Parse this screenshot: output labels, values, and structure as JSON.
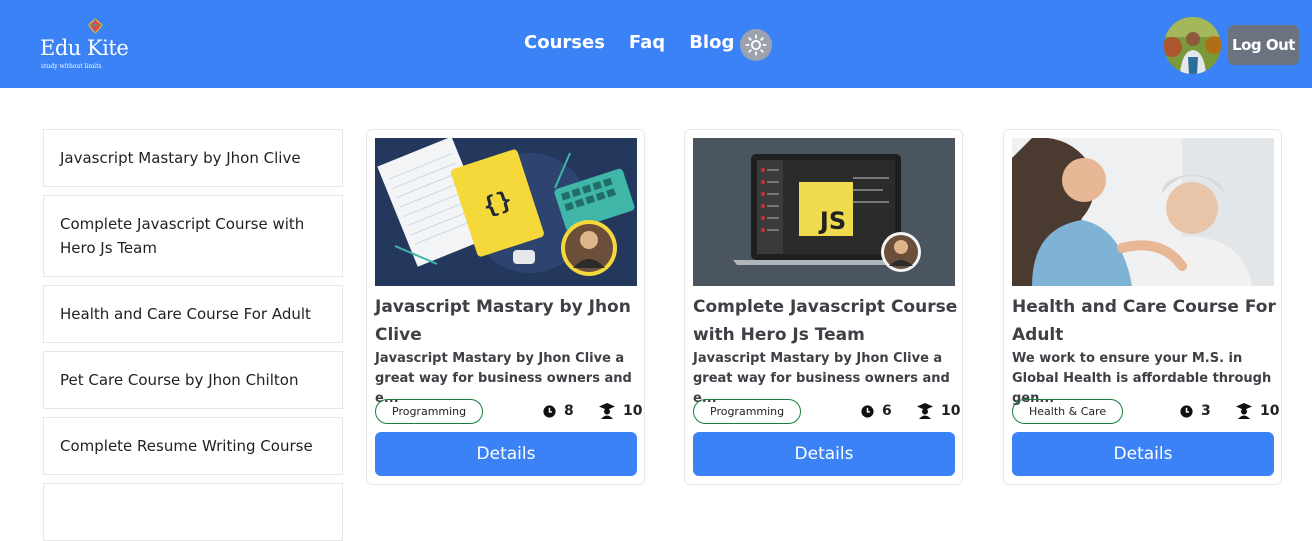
{
  "brand": {
    "name": "Edu Kite",
    "tagline": "study without limits"
  },
  "nav": {
    "links": [
      "Courses",
      "Faq",
      "Blog"
    ]
  },
  "header": {
    "logout_label": "Log Out"
  },
  "sidebar": {
    "items": [
      "Javascript Mastary by Jhon Clive",
      "Complete Javascript Course with Hero Js Team",
      "Health and Care Course For Adult",
      "Pet Care Course by Jhon Chilton",
      "Complete Resume Writing Course"
    ]
  },
  "courses": [
    {
      "title": "Javascript Mastary by Jhon Clive",
      "description": "Javascript Mastary by Jhon Clive a great way for business owners and e...",
      "category": "Programming",
      "duration": "8",
      "students": "10",
      "button": "Details"
    },
    {
      "title": "Complete Javascript Course with Hero Js Team",
      "description": "Javascript Mastary by Jhon Clive a great way for business owners and e...",
      "category": "Programming",
      "duration": "6",
      "students": "10",
      "button": "Details"
    },
    {
      "title": "Health and Care Course For Adult",
      "description": "We work to ensure your M.S. in Global Health is affordable through gen...",
      "category": "Health & Care",
      "duration": "3",
      "students": "10",
      "button": "Details"
    }
  ],
  "colors": {
    "primary": "#3b82f6",
    "tag_border": "#15803d",
    "logout_bg": "#6b7280"
  },
  "icons": [
    "kite-icon",
    "sun-icon",
    "clock-icon",
    "graduate-icon"
  ]
}
